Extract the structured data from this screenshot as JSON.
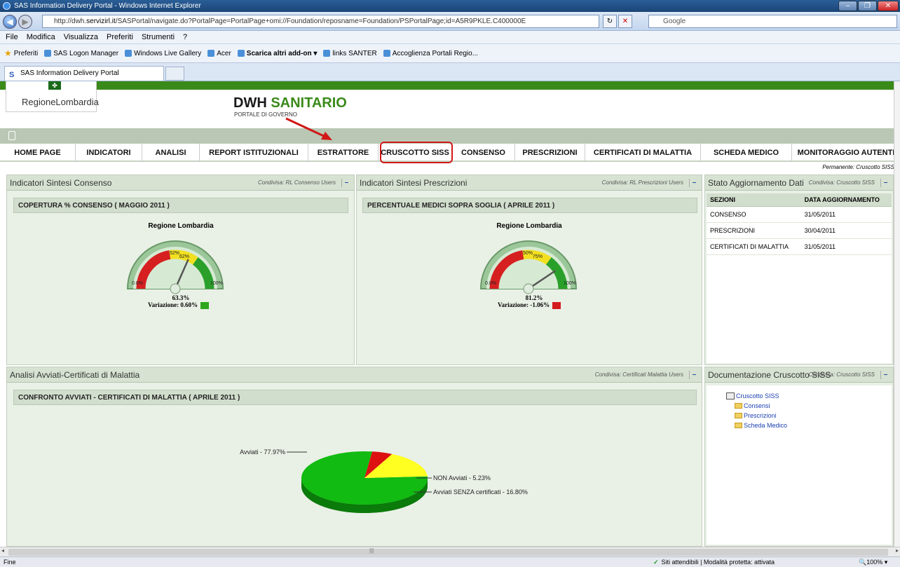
{
  "window": {
    "title": "SAS Information Delivery Portal - Windows Internet Explorer"
  },
  "address": {
    "prefix": "http://dwh.",
    "domain": "servizirl.it",
    "path": "/SASPortal/navigate.do?PortalPage=PortalPage+omi://Foundation/reposname=Foundation/PSPortalPage;id=A5R9PKLE.C400000E"
  },
  "search": {
    "placeholder": "Google"
  },
  "menu": [
    "File",
    "Modifica",
    "Visualizza",
    "Preferiti",
    "Strumenti",
    "?"
  ],
  "favorites": {
    "label": "Preferiti",
    "items": [
      "SAS Logon Manager",
      "Windows Live Gallery",
      "Acer",
      "Scarica altri add-on ▾",
      "links SANTER",
      "Accoglienza Portali Regio..."
    ]
  },
  "tab": {
    "label": "SAS Information Delivery Portal"
  },
  "portal": {
    "logo": "RegioneLombardia",
    "title_a": "DWH",
    "title_b": "SANITARIO",
    "subtitle": "PORTALE DI GOVERNO",
    "nav": [
      "HOME PAGE",
      "INDICATORI",
      "ANALISI",
      "REPORT ISTITUZIONALI",
      "ESTRATTORE",
      "CRUSCOTTO SISS",
      "CONSENSO",
      "PRESCRIZIONI",
      "CERTIFICATI DI MALATTIA",
      "SCHEDA MEDICO",
      "MONITORAGGIO AUTENTI"
    ],
    "permanent": "Permanente: Cruscotto SISS"
  },
  "panels": {
    "consenso": {
      "title": "Indicatori Sintesi Consenso",
      "cond": "Condivisa: RL Consenso Users",
      "section": "COPERTURA % CONSENSO ( MAGGIO 2011 )",
      "gauge_title": "Regione Lombardia",
      "value": "63.3%",
      "variazione": "Variazione:  0.60%",
      "labels": {
        "min": "0.0%",
        "t1": "52%",
        "t2": "62%",
        "max": "100%"
      },
      "needle": 0.633
    },
    "prescrizioni": {
      "title": "Indicatori Sintesi Prescrizioni",
      "cond": "Condivisa: RL Prescrizioni Users",
      "section": "PERCENTUALE MEDICI SOPRA SOGLIA ( APRILE 2011 )",
      "gauge_title": "Regione Lombardia",
      "value": "81.2%",
      "variazione": "Variazione: -1.06%",
      "labels": {
        "min": "0.0%",
        "t1": "50%",
        "t2": "75%",
        "max": "100%"
      },
      "needle": 0.812
    },
    "stato": {
      "title": "Stato Aggiornamento Dati",
      "cond": "Condivisa: Cruscotto SISS",
      "headers": [
        "SEZIONI",
        "DATA AGGIORNAMENTO"
      ],
      "rows": [
        [
          "CONSENSO",
          "31/05/2011"
        ],
        [
          "PRESCRIZIONI",
          "30/04/2011"
        ],
        [
          "CERTIFICATI DI MALATTIA",
          "31/05/2011"
        ]
      ]
    },
    "analisi": {
      "title": "Analisi Avviati-Certificati di Malattia",
      "cond": "Condivisa: Certificati Malattia Users",
      "section": "CONFRONTO AVVIATI - CERTIFICATI DI MALATTIA ( APRILE 2011 )",
      "pie": [
        {
          "label": "Avviati - 77.97%",
          "value": 77.97,
          "color": "#11bb11"
        },
        {
          "label": "NON Avviati - 5.23%",
          "value": 5.23,
          "color": "#dd1111"
        },
        {
          "label": "Avviati SENZA certificati - 16.80%",
          "value": 16.8,
          "color": "#ffff22"
        }
      ]
    },
    "doc": {
      "title": "Documentazione Cruscotto SISS",
      "cond": "Condivisa: Cruscotto SISS",
      "root": "Cruscotto SISS",
      "children": [
        "Consensi",
        "Prescrizioni",
        "Scheda Medico"
      ]
    }
  },
  "status": {
    "left": "Fine",
    "zone": "Siti attendibili | Modalità protetta: attivata",
    "zoom": "100%"
  }
}
